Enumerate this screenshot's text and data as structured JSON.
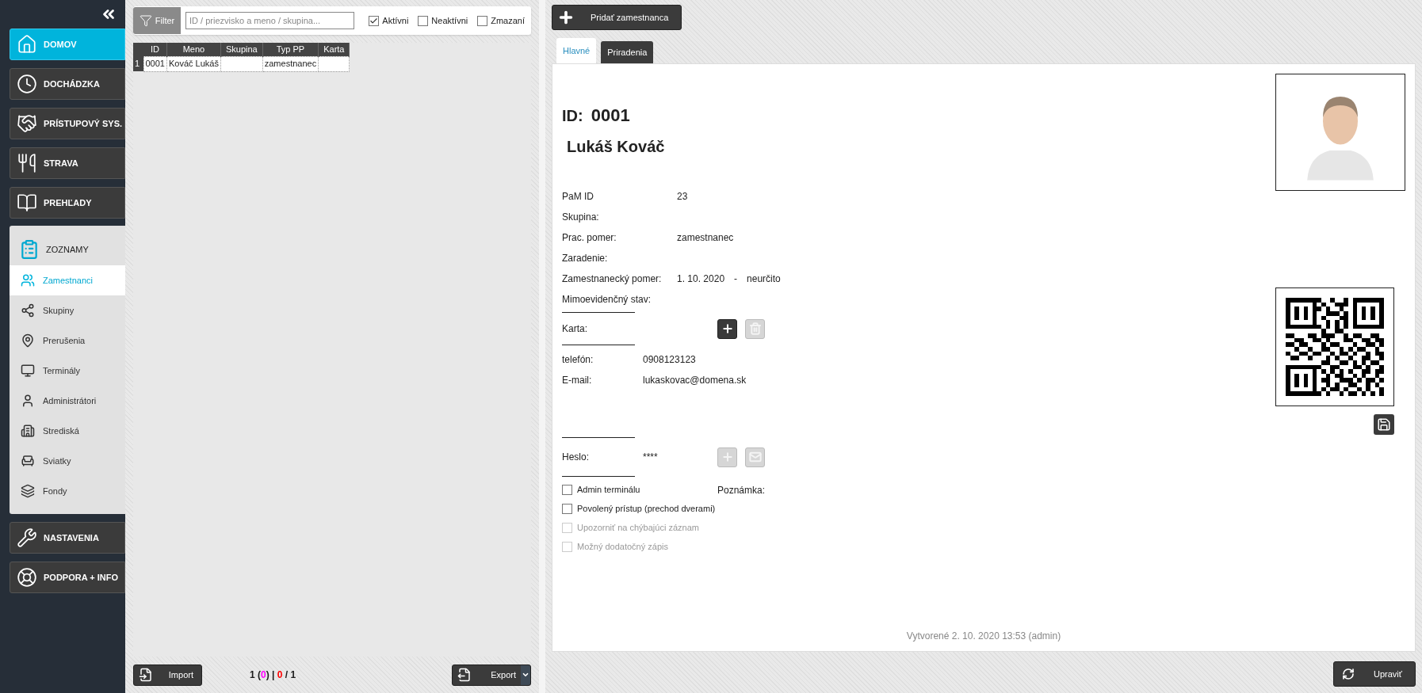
{
  "sidebar": {
    "nav_top": [
      {
        "label": "DOMOV",
        "selected": true
      },
      {
        "label": "DOCHÁDZKA",
        "selected": false
      },
      {
        "label": "PRÍSTUPOVÝ SYS.",
        "selected": false
      },
      {
        "label": "STRAVA",
        "selected": false
      },
      {
        "label": "PREHĽADY",
        "selected": false
      }
    ],
    "section": {
      "title": "ZOZNAMY",
      "expanded": true,
      "items": [
        {
          "label": "Zamestnanci",
          "selected": true
        },
        {
          "label": "Skupiny",
          "selected": false
        },
        {
          "label": "Prerušenia",
          "selected": false
        },
        {
          "label": "Terminály",
          "selected": false
        },
        {
          "label": "Administrátori",
          "selected": false
        },
        {
          "label": "Strediská",
          "selected": false
        },
        {
          "label": "Sviatky",
          "selected": false
        },
        {
          "label": "Fondy",
          "selected": false
        }
      ]
    },
    "nav_bottom": [
      {
        "label": "NASTAVENIA",
        "selected": false
      },
      {
        "label": "PODPORA + INFO",
        "selected": false
      }
    ]
  },
  "filter": {
    "button": "Filter",
    "search": {
      "placeholder": "ID / priezvisko a meno / skupina..."
    },
    "checkboxes": [
      {
        "label": "Aktívni",
        "checked": true
      },
      {
        "label": "Neaktívni",
        "checked": false
      },
      {
        "label": "Zmazaní",
        "checked": false
      }
    ]
  },
  "table": {
    "columns": [
      "ID",
      "Meno",
      "Skupina",
      "Typ PP",
      "Karta"
    ],
    "rows": [
      {
        "number": "1",
        "cells": [
          "0001",
          "Kováč Lukáš",
          null,
          "zamestnanec",
          null
        ]
      }
    ]
  },
  "bottom_bar": {
    "import": "Import",
    "export": "Export",
    "counter": [
      {
        "text": "1 (",
        "color": "#1a1a1a"
      },
      {
        "text": "0",
        "color": "#ff00ff"
      },
      {
        "text": ") | ",
        "color": "#1a1a1a"
      },
      {
        "text": "0",
        "color": "#ff0000"
      },
      {
        "text": " / 1",
        "color": "#1a1a1a"
      }
    ]
  },
  "toolbar": {
    "add_button": "Pridať zamestnanca"
  },
  "tabs": [
    {
      "label": "Hlavné",
      "selected": true
    },
    {
      "label": "Priradenia",
      "selected": false
    }
  ],
  "employee": {
    "id_label": "ID:",
    "id": "0001",
    "name": "Lukáš Kováč",
    "fields": [
      {
        "label": "PaM ID",
        "value": "23"
      },
      {
        "label": "Skupina:"
      },
      {
        "label": "Prac. pomer:",
        "value": "zamestnanec"
      },
      {
        "label": "Zaradenie:"
      },
      {
        "label": "Zamestnanecký pomer:",
        "value": "1. 10. 2020",
        "separator": "-",
        "value_end": "neurčito"
      },
      {
        "label": "Mimoevidenčný stav:"
      }
    ],
    "card": {
      "label": "Karta:",
      "add_disabled": false,
      "delete_disabled": true
    },
    "contacts": [
      {
        "label": "telefón:",
        "value": "0908123123"
      },
      {
        "label": "E-mail:",
        "value": "lukaskovac@domena.sk"
      }
    ],
    "password": {
      "label": "Heslo:",
      "value": "****",
      "add_disabled": true,
      "mail_disabled": true
    },
    "options": [
      {
        "label": "Admin terminálu",
        "checked": false,
        "disabled": false
      },
      {
        "label": "Povolený prístup (prechod dverami)",
        "checked": false,
        "disabled": false
      },
      {
        "label": "Upozorniť na chýbajúci záznam",
        "checked": false,
        "disabled": true
      },
      {
        "label": "Možný dodatočný zápis",
        "checked": false,
        "disabled": true
      }
    ],
    "note_label": "Poznámka:",
    "created": "Vytvorené 2. 10. 2020 13:53 (admin)"
  },
  "edit_button": "Upraviť"
}
